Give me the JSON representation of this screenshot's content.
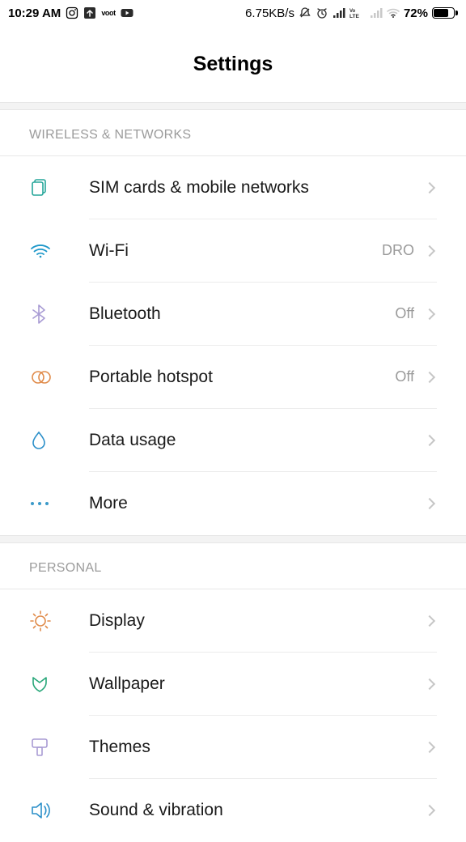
{
  "statusbar": {
    "time": "10:29 AM",
    "speed": "6.75KB/s",
    "battery_pct": "72%"
  },
  "header": {
    "title": "Settings"
  },
  "sections": [
    {
      "title": "WIRELESS & NETWORKS",
      "items": [
        {
          "label": "SIM cards & mobile networks",
          "value": ""
        },
        {
          "label": "Wi-Fi",
          "value": "DRO"
        },
        {
          "label": "Bluetooth",
          "value": "Off"
        },
        {
          "label": "Portable hotspot",
          "value": "Off"
        },
        {
          "label": "Data usage",
          "value": ""
        },
        {
          "label": "More",
          "value": ""
        }
      ]
    },
    {
      "title": "PERSONAL",
      "items": [
        {
          "label": "Display",
          "value": ""
        },
        {
          "label": "Wallpaper",
          "value": ""
        },
        {
          "label": "Themes",
          "value": ""
        },
        {
          "label": "Sound & vibration",
          "value": ""
        }
      ]
    }
  ]
}
